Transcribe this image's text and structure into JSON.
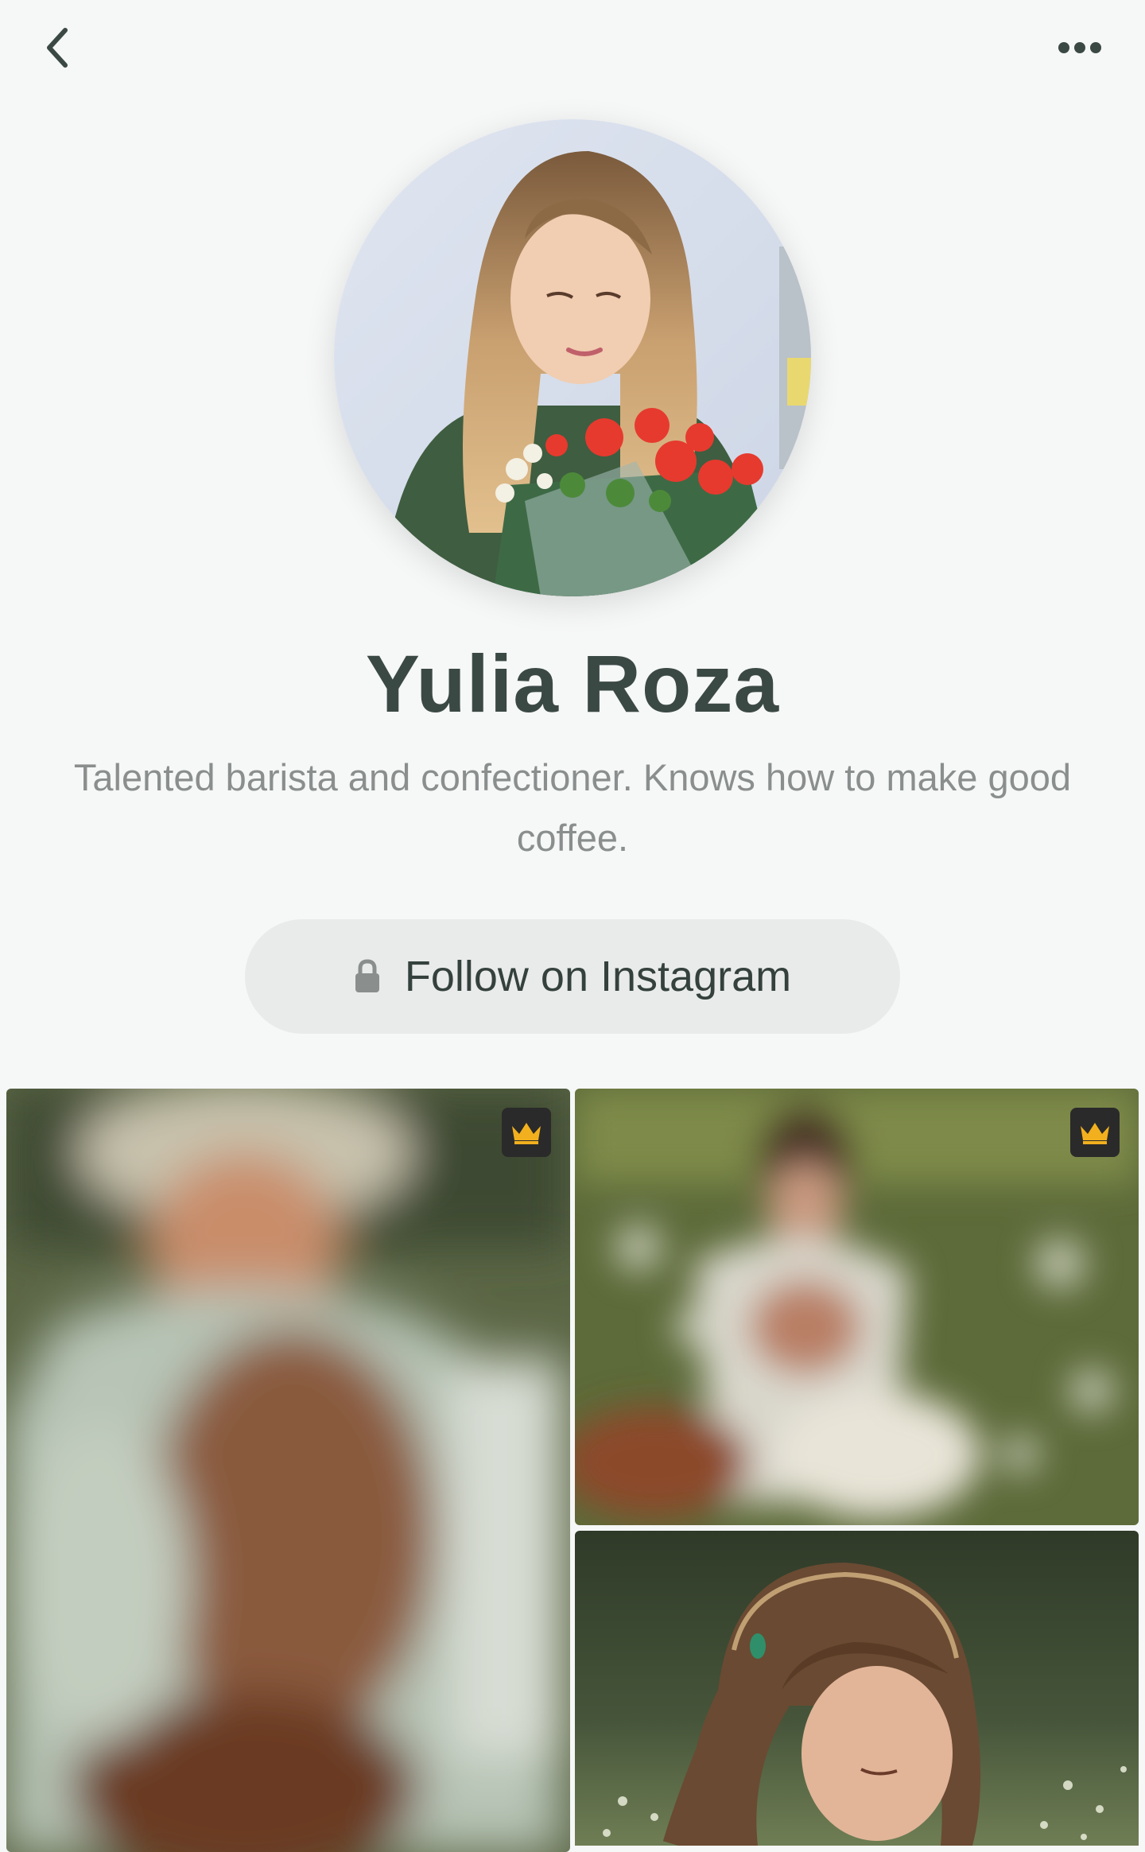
{
  "header": {
    "back_icon": "chevron-left-icon",
    "more_icon": "more-horizontal-icon"
  },
  "profile": {
    "name": "Yulia Roza",
    "bio": "Talented barista and confectioner. Knows how to make good coffee.",
    "follow_label": "Follow on Instagram",
    "follow_icon": "lock-icon"
  },
  "gallery": {
    "tiles": [
      {
        "premium": true,
        "blurred": true,
        "badge_icon": "crown-icon"
      },
      {
        "premium": true,
        "blurred": true,
        "badge_icon": "crown-icon"
      },
      {
        "premium": false,
        "blurred": false
      }
    ]
  },
  "colors": {
    "background": "#f6f7f7",
    "title": "#3b4945",
    "bio": "#8a8f8e",
    "button_bg": "#e9ebeb",
    "badge_bg": "#2a2a2a",
    "crown": "#f2b01e"
  }
}
